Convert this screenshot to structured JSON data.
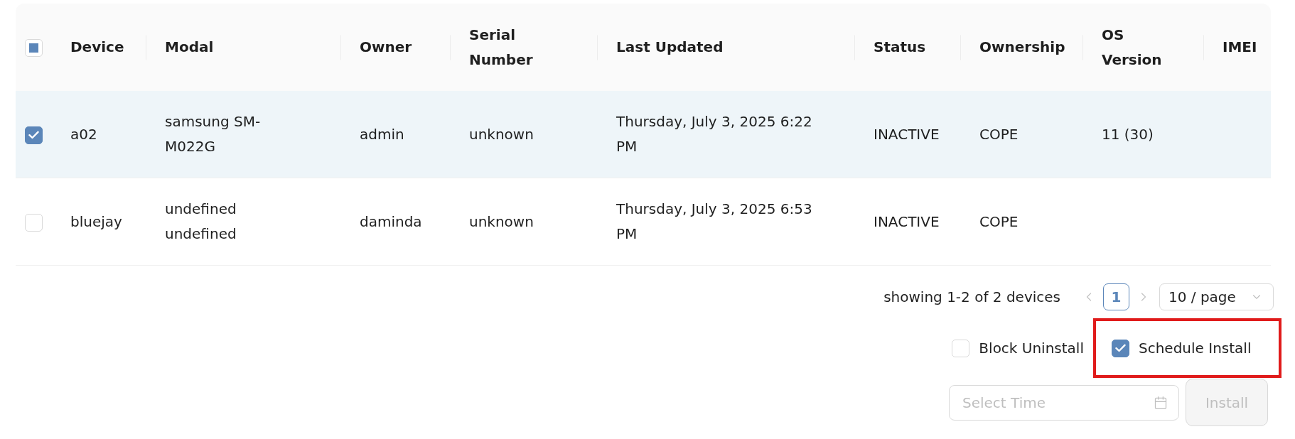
{
  "table": {
    "select_all": {
      "checked": false,
      "indeterminate": true
    },
    "columns": [
      "Device",
      "Modal",
      "Owner",
      "Serial Number",
      "Last Updated",
      "Status",
      "Ownership",
      "OS Version",
      "IMEI"
    ],
    "rows": [
      {
        "selected": true,
        "cells": [
          "a02",
          "samsung SM-M022G",
          "admin",
          "unknown",
          "Thursday, July 3, 2025 6:22 PM",
          "INACTIVE",
          "COPE",
          "11 (30)"
        ]
      },
      {
        "selected": false,
        "cells": [
          "bluejay",
          "undefined undefined",
          "daminda",
          "unknown",
          "Thursday, July 3, 2025 6:53 PM",
          "INACTIVE",
          "COPE"
        ]
      }
    ]
  },
  "pagination": {
    "summary": "showing 1-2 of 2 devices",
    "previous": {
      "disabled": true
    },
    "pages": [
      {
        "label": "1",
        "selected": true
      }
    ],
    "next": {
      "disabled": true
    },
    "page_size": "10 / page"
  },
  "options": [
    {
      "label": "Block Uninstall",
      "checked": false,
      "highlighted": false
    },
    {
      "label": "Schedule Install",
      "checked": true,
      "highlighted": true
    }
  ],
  "time_field": {
    "placeholder": "Select Time"
  },
  "install_button": {
    "label": "Install",
    "disabled": true
  }
}
